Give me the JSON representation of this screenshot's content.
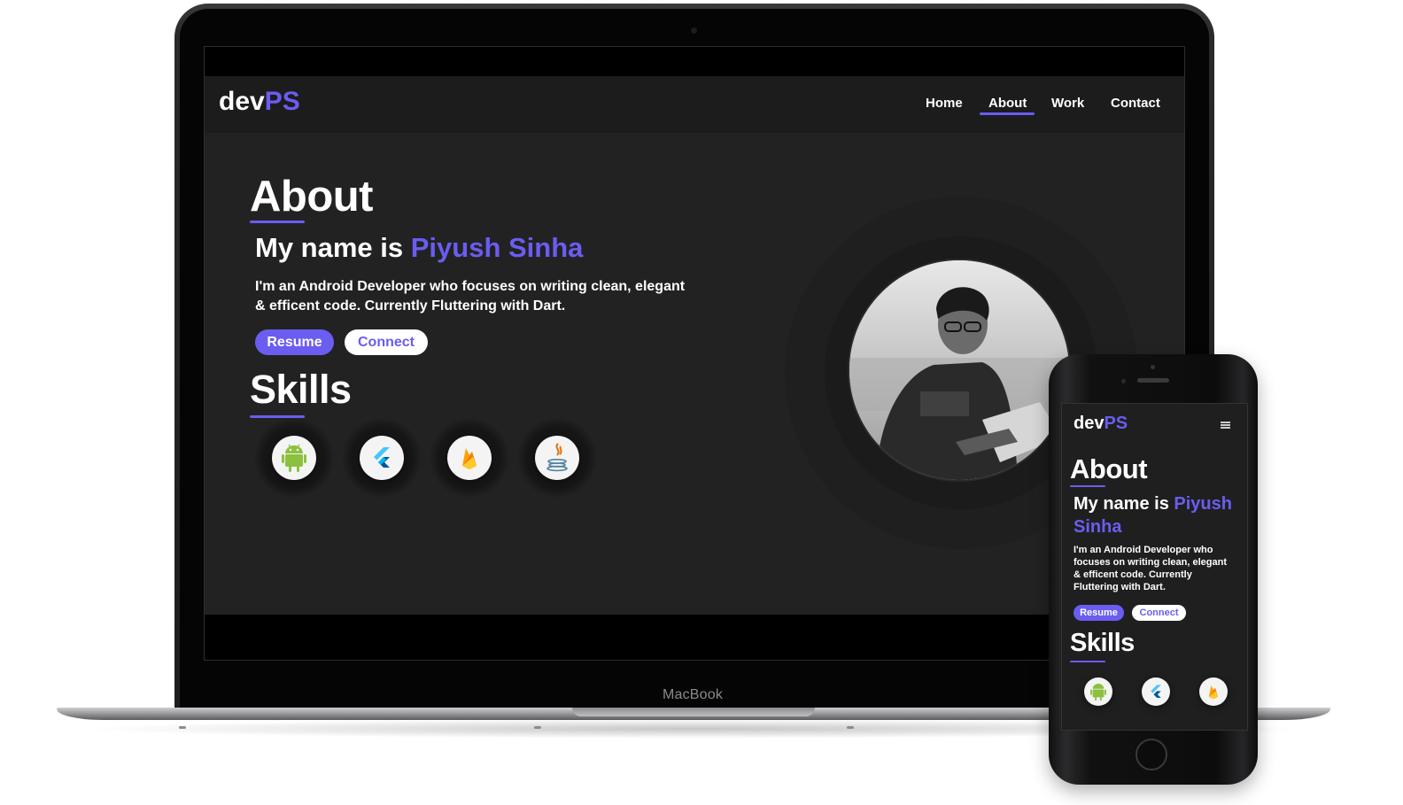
{
  "laptop": {
    "brand_label": "MacBook"
  },
  "site": {
    "logo": {
      "text": "dev",
      "accent": "PS"
    },
    "nav": [
      {
        "label": "Home"
      },
      {
        "label": "About",
        "active": true
      },
      {
        "label": "Work"
      },
      {
        "label": "Contact"
      }
    ],
    "about": {
      "heading": "About",
      "intro_prefix": "My name is ",
      "name": "Piyush Sinha",
      "description_line1": "I'm an Android Developer who focuses on writing clean, elegant",
      "description_line2": "& efficent code. Currently Fluttering with Dart."
    },
    "buttons": {
      "resume": "Resume",
      "connect": "Connect"
    },
    "skills": {
      "heading": "Skills",
      "items": [
        {
          "icon": "android-icon"
        },
        {
          "icon": "flutter-icon"
        },
        {
          "icon": "firebase-icon"
        },
        {
          "icon": "java-icon"
        }
      ]
    },
    "accent_color": "#6a5df0"
  },
  "mobile": {
    "logo": {
      "text": "dev",
      "accent": "PS"
    },
    "about": {
      "heading": "About",
      "intro_prefix": "My name is ",
      "name_line1": "Piyush",
      "name_line2": "Sinha",
      "description_line1": "I'm an Android Developer who",
      "description_line2": "focuses on writing clean, elegant",
      "description_line3": "& efficent code. Currently",
      "description_line4": "Fluttering with Dart."
    },
    "buttons": {
      "resume": "Resume",
      "connect": "Connect"
    },
    "skills": {
      "heading": "Skills"
    }
  }
}
